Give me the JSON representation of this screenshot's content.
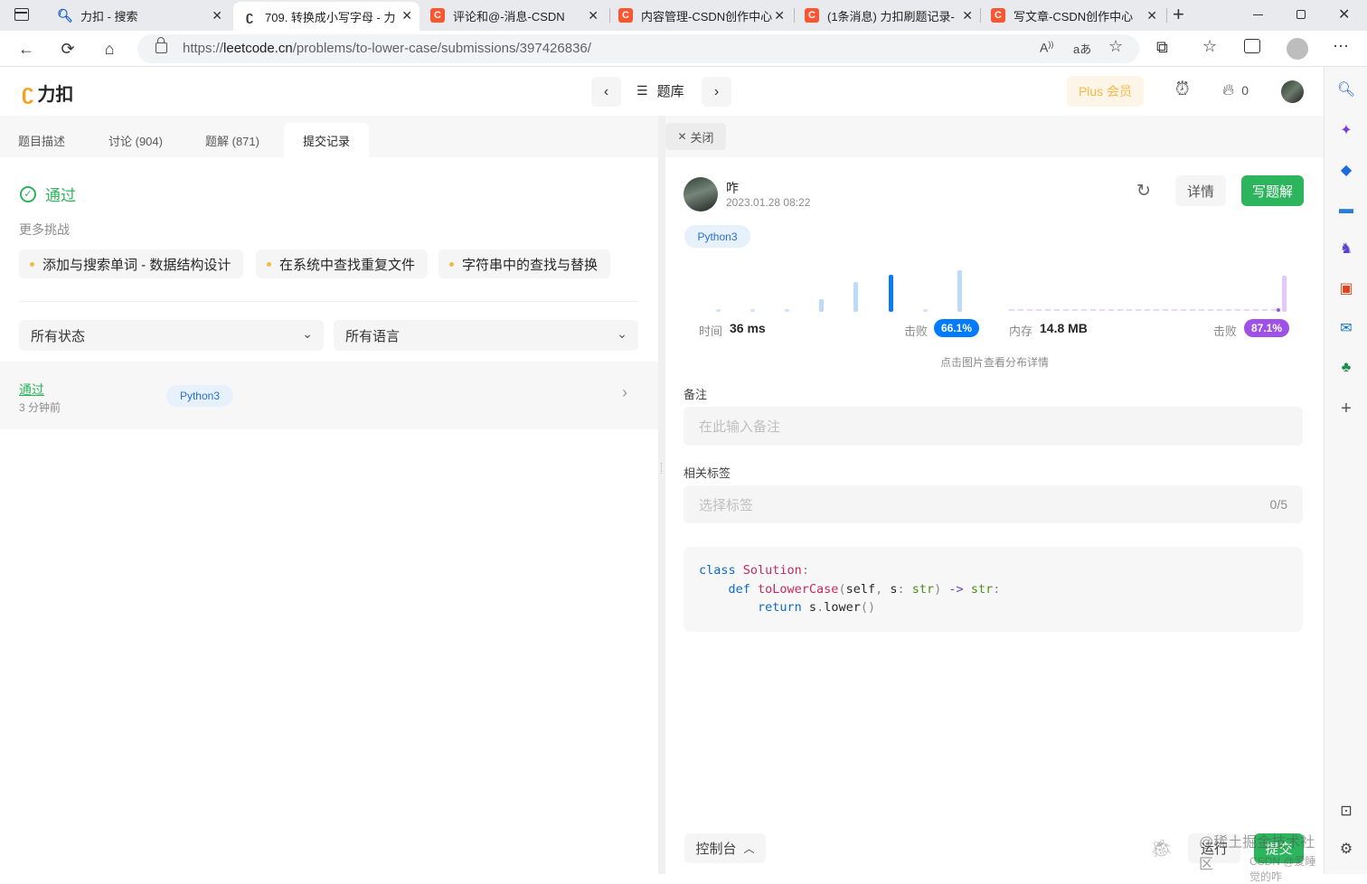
{
  "browser": {
    "tabs": [
      {
        "title": "力扣 - 搜索",
        "icon": "search-icon",
        "active": false
      },
      {
        "title": "709. 转换成小写字母 - 力",
        "icon": "leetcode-icon",
        "active": true
      },
      {
        "title": "评论和@-消息-CSDN",
        "icon": "csdn-icon",
        "active": false
      },
      {
        "title": "内容管理-CSDN创作中心",
        "icon": "csdn-icon",
        "active": false
      },
      {
        "title": "(1条消息) 力扣刷题记录-",
        "icon": "csdn-icon",
        "active": false
      },
      {
        "title": "写文章-CSDN创作中心",
        "icon": "csdn-icon",
        "active": false
      }
    ],
    "new_tab_label": "+",
    "url_prefix": "https://",
    "url_domain": "leetcode.cn",
    "url_path": "/problems/to-lower-case/submissions/397426836/"
  },
  "header": {
    "logo_text": "力扣",
    "problems_label": "题库",
    "plus_label": "Plus 会员",
    "streak_count": "0"
  },
  "left": {
    "tabs": [
      {
        "label": "题目描述",
        "active": false
      },
      {
        "label": "讨论 (904)",
        "active": false
      },
      {
        "label": "题解 (871)",
        "active": false
      },
      {
        "label": "提交记录",
        "active": true
      }
    ],
    "status": "通过",
    "more_challenges_label": "更多挑战",
    "challenges": [
      "添加与搜索单词 - 数据结构设计",
      "在系统中查找重复文件",
      "字符串中的查找与替换"
    ],
    "filter_status": "所有状态",
    "filter_language": "所有语言",
    "submission": {
      "status": "通过",
      "time_ago": "3 分钟前",
      "language": "Python3"
    }
  },
  "right": {
    "close_label": "关闭",
    "user_name": "咋",
    "timestamp": "2023.01.28 08:22",
    "details_label": "详情",
    "write_solution_label": "写题解",
    "language": "Python3",
    "time_label": "时间",
    "time_value": "36 ms",
    "beat_label_1": "击败",
    "time_beat": "66.1%",
    "memory_label": "内存",
    "memory_value": "14.8 MB",
    "beat_label_2": "击败",
    "memory_beat": "87.1%",
    "chart_hint": "点击图片查看分布详情",
    "notes_label": "备注",
    "notes_placeholder": "在此输入备注",
    "tags_label": "相关标签",
    "tags_placeholder": "选择标签",
    "tags_count": "0/5",
    "code_lines": [
      [
        {
          "t": "class ",
          "c": "kw"
        },
        {
          "t": "Solution",
          "c": "cls"
        },
        {
          "t": ":",
          "c": "pn"
        }
      ],
      [
        {
          "t": "    def ",
          "c": "kw"
        },
        {
          "t": "toLowerCase",
          "c": "fn"
        },
        {
          "t": "(",
          "c": "pn"
        },
        {
          "t": "self",
          "c": "nm"
        },
        {
          "t": ", ",
          "c": "pn"
        },
        {
          "t": "s",
          "c": "nm"
        },
        {
          "t": ": ",
          "c": "pn"
        },
        {
          "t": "str",
          "c": "ty"
        },
        {
          "t": ") ",
          "c": "pn"
        },
        {
          "t": "->",
          "c": "op"
        },
        {
          "t": " str",
          "c": "ty"
        },
        {
          "t": ":",
          "c": "pn"
        }
      ],
      [
        {
          "t": "        return ",
          "c": "kw"
        },
        {
          "t": "s",
          "c": "nm"
        },
        {
          "t": ".",
          "c": "pn"
        },
        {
          "t": "lower",
          "c": "nm"
        },
        {
          "t": "()",
          "c": "pn"
        }
      ]
    ],
    "console_label": "控制台",
    "run_label": "运行",
    "submit_label": "提交",
    "watermark_1": "@稀土掘金技术社区",
    "watermark_2": "CSDN @爱睡觉的咋"
  },
  "colors": {
    "accent_green": "#2db55d",
    "blue": "#007aff",
    "purple": "#9f50e7",
    "plus_gold": "#f6b845"
  }
}
